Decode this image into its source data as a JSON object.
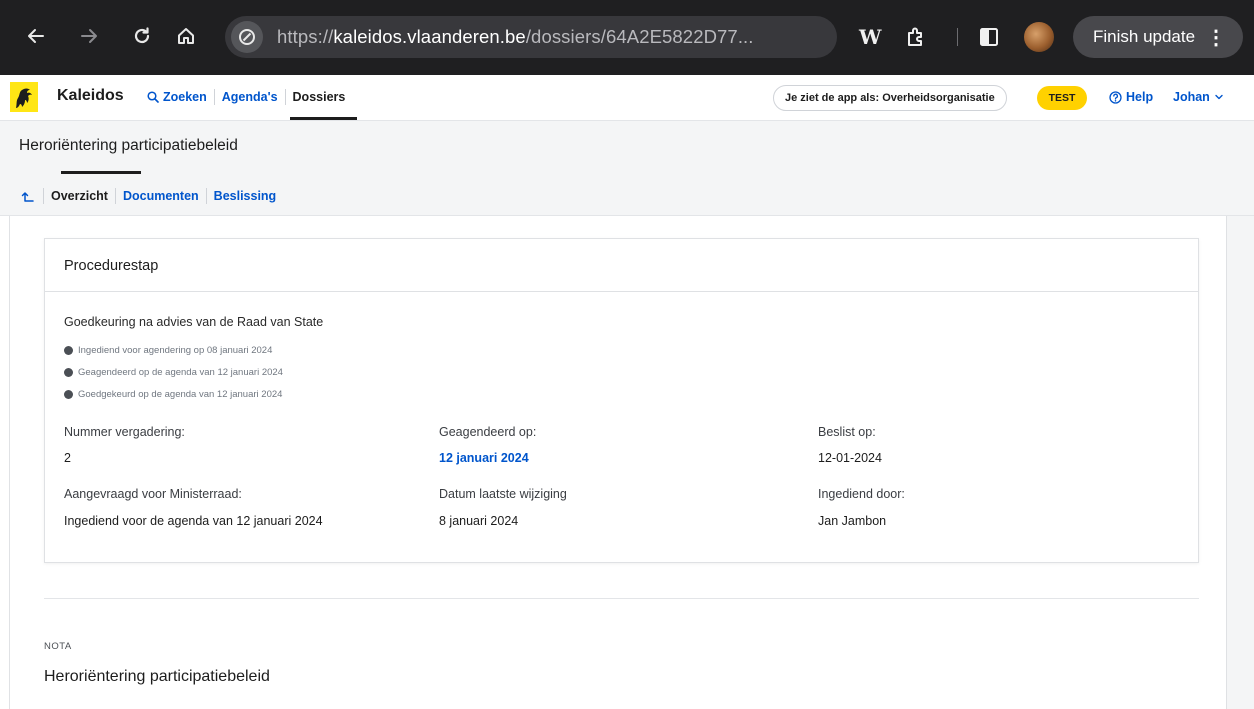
{
  "browser": {
    "url_scheme": "https://",
    "url_host": "kaleidos.vlaanderen.be",
    "url_path": "/dossiers/64A2E5822D77...",
    "wikipedia_glyph": "W",
    "finish_update_label": "Finish update",
    "menu_glyph": "⋮"
  },
  "header": {
    "brand": "Kaleidos",
    "nav": {
      "search": "Zoeken",
      "agendas": "Agenda's",
      "dossiers": "Dossiers"
    },
    "view_as": "Je ziet de app als: Overheidsorganisatie",
    "badge": "TEST",
    "help": "Help",
    "user": "Johan"
  },
  "subheader": {
    "title": "Heroriëntering participatiebeleid",
    "tabs": {
      "overview": "Overzicht",
      "documents": "Documenten",
      "decision": "Beslissing"
    }
  },
  "card": {
    "title": "Procedurestap",
    "step_title": "Goedkeuring na advies van de Raad van State",
    "timeline": [
      "Ingediend voor agendering op 08 januari 2024",
      "Geagendeerd op de agenda van 12 januari 2024",
      "Goedgekeurd op de agenda van 12 januari 2024"
    ],
    "fields": {
      "meeting_number_label": "Nummer vergadering:",
      "meeting_number_value": "2",
      "scheduled_label": "Geagendeerd op:",
      "scheduled_value": "12 januari 2024",
      "decided_label": "Beslist op:",
      "decided_value": "12-01-2024",
      "requested_label": "Aangevraagd voor Ministerraad:",
      "requested_value": "Ingediend voor de agenda van 12 januari 2024",
      "last_modified_label": "Datum laatste wijziging",
      "last_modified_value": "8 januari 2024",
      "submitted_by_label": "Ingediend door:",
      "submitted_by_value": "Jan Jambon"
    }
  },
  "nota": {
    "label": "NOTA",
    "title": "Heroriëntering participatiebeleid"
  },
  "colors": {
    "link": "#0055cc",
    "badge": "#ffd100",
    "chrome_bg": "#1f1f21"
  }
}
